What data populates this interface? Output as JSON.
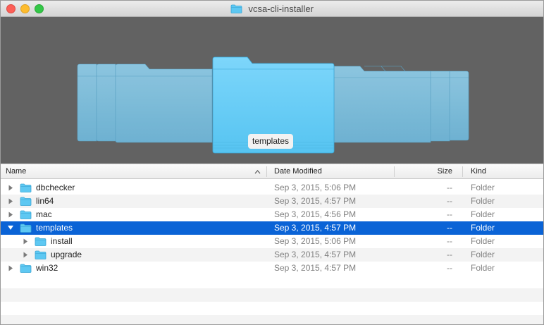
{
  "window": {
    "title": "vcsa-cli-installer"
  },
  "coverflow": {
    "selected_label": "templates",
    "folder_color": "#5ec8f2"
  },
  "columns": {
    "name": "Name",
    "date_modified": "Date Modified",
    "size": "Size",
    "kind": "Kind",
    "sort_indicator": "^"
  },
  "icons": {
    "collapsed": "disclosure-right-icon",
    "expanded": "disclosure-down-icon",
    "folder": "folder-icon"
  },
  "rows": [
    {
      "name": "dbchecker",
      "date": "Sep 3, 2015, 5:06 PM",
      "size": "--",
      "kind": "Folder",
      "expanded": false,
      "level": 0,
      "selected": false
    },
    {
      "name": "lin64",
      "date": "Sep 3, 2015, 4:57 PM",
      "size": "--",
      "kind": "Folder",
      "expanded": false,
      "level": 0,
      "selected": false
    },
    {
      "name": "mac",
      "date": "Sep 3, 2015, 4:56 PM",
      "size": "--",
      "kind": "Folder",
      "expanded": false,
      "level": 0,
      "selected": false
    },
    {
      "name": "templates",
      "date": "Sep 3, 2015, 4:57 PM",
      "size": "--",
      "kind": "Folder",
      "expanded": true,
      "level": 0,
      "selected": true
    },
    {
      "name": "install",
      "date": "Sep 3, 2015, 5:06 PM",
      "size": "--",
      "kind": "Folder",
      "expanded": false,
      "level": 1,
      "selected": false
    },
    {
      "name": "upgrade",
      "date": "Sep 3, 2015, 4:57 PM",
      "size": "--",
      "kind": "Folder",
      "expanded": false,
      "level": 1,
      "selected": false
    },
    {
      "name": "win32",
      "date": "Sep 3, 2015, 4:57 PM",
      "size": "--",
      "kind": "Folder",
      "expanded": false,
      "level": 0,
      "selected": false
    }
  ]
}
